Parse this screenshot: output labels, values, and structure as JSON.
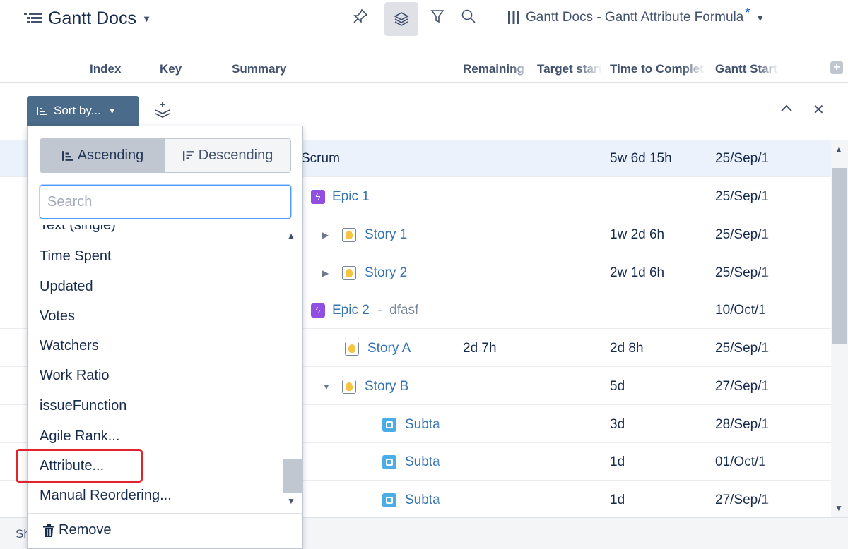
{
  "header": {
    "app_title": "Gantt Docs",
    "view_name": "Gantt Docs - Gantt Attribute Formula",
    "view_modified_mark": "*"
  },
  "toolbar_icons": [
    "pin-icon",
    "layers-icon",
    "filter-icon",
    "search-icon",
    "columns-icon"
  ],
  "columns": [
    {
      "key": "index",
      "label": "Index"
    },
    {
      "key": "key",
      "label": "Key"
    },
    {
      "key": "summary",
      "label": "Summary"
    },
    {
      "key": "remaining",
      "label": "Remaining"
    },
    {
      "key": "target_start",
      "label": "Target start"
    },
    {
      "key": "time_to_complete",
      "label": "Time to Complete"
    },
    {
      "key": "gantt_start",
      "label": "Gantt Start"
    }
  ],
  "sort_panel": {
    "button_label": "Sort by...",
    "ascending_label": "Ascending",
    "descending_label": "Descending",
    "search_placeholder": "Search",
    "search_value": "",
    "items": [
      "Text (single)",
      "Time Spent",
      "Updated",
      "Votes",
      "Watchers",
      "Work Ratio",
      "issueFunction",
      "Agile Rank...",
      "Attribute...",
      "Manual Reordering..."
    ],
    "remove_label": "Remove",
    "highlighted_item": "Attribute..."
  },
  "rows": [
    {
      "summary": "Scrum",
      "type": "project",
      "remaining": "",
      "ttc": "5w 6d 15h",
      "gantt_start": "25/Sep/1"
    },
    {
      "summary": "Epic 1",
      "type": "epic",
      "remaining": "",
      "ttc": "",
      "gantt_start": "25/Sep/1"
    },
    {
      "summary": "Story 1",
      "type": "story",
      "remaining": "",
      "ttc": "1w 2d 6h",
      "gantt_start": "25/Sep/1"
    },
    {
      "summary": "Story 2",
      "type": "story",
      "remaining": "",
      "ttc": "2w 1d 6h",
      "gantt_start": "25/Sep/1"
    },
    {
      "summary": "Epic 2",
      "suffix_sep": "-",
      "suffix": "dfasf",
      "type": "epic",
      "remaining": "",
      "ttc": "",
      "gantt_start": "10/Oct/1"
    },
    {
      "summary": "Story A",
      "type": "story",
      "remaining": "2d 7h",
      "ttc": "2d 8h",
      "gantt_start": "25/Sep/1"
    },
    {
      "summary": "Story B",
      "type": "story",
      "remaining": "",
      "ttc": "5d",
      "gantt_start": "27/Sep/1"
    },
    {
      "summary": "Subta",
      "type": "subtask",
      "remaining": "",
      "ttc": "3d",
      "gantt_start": "28/Sep/1"
    },
    {
      "summary": "Subta",
      "type": "subtask",
      "remaining": "",
      "ttc": "1d",
      "gantt_start": "01/Oct/1"
    },
    {
      "summary": "Subta",
      "type": "subtask",
      "remaining": "",
      "ttc": "1d",
      "gantt_start": "27/Sep/1"
    }
  ],
  "footer": {
    "text": "Sh"
  },
  "colors": {
    "accent": "#4a6b8a",
    "link": "#3572b0",
    "epic": "#904ee2",
    "subtask": "#4bade8",
    "highlight": "#e3232c"
  }
}
